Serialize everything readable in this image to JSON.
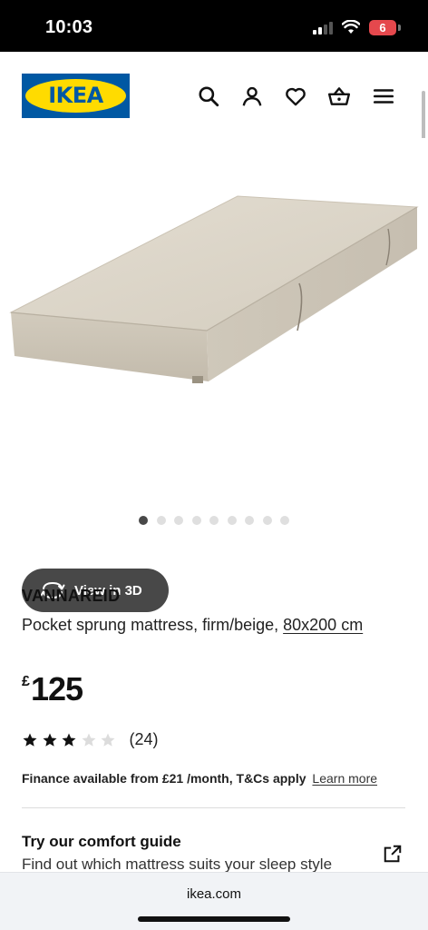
{
  "status_bar": {
    "time": "10:03",
    "battery": "6",
    "battery_color": "#e5484d"
  },
  "header": {
    "logo_text": "IKEA",
    "brand_colors": {
      "blue": "#0058a3",
      "yellow": "#ffdb00"
    },
    "icons": [
      "search-icon",
      "user-icon",
      "heart-icon",
      "basket-icon",
      "menu-icon"
    ]
  },
  "gallery": {
    "view_3d_label": "View in 3D",
    "view_3d_icon": "rotate-icon",
    "image_count": 9,
    "active_index": 0
  },
  "product": {
    "name": "VANNAREID",
    "description": "Pocket sprung mattress, firm/beige,",
    "size": "80x200 cm",
    "currency": "£",
    "price": "125",
    "rating": {
      "value": 3,
      "max": 5,
      "count_label": "(24)"
    },
    "finance_text": "Finance available from £21 /month, T&Cs apply",
    "finance_link": "Learn more"
  },
  "comfort_guide": {
    "title": "Try our comfort guide",
    "subtitle": "Find out which mattress suits your sleep style",
    "icon": "external-link-icon"
  },
  "browser": {
    "url": "ikea.com"
  }
}
